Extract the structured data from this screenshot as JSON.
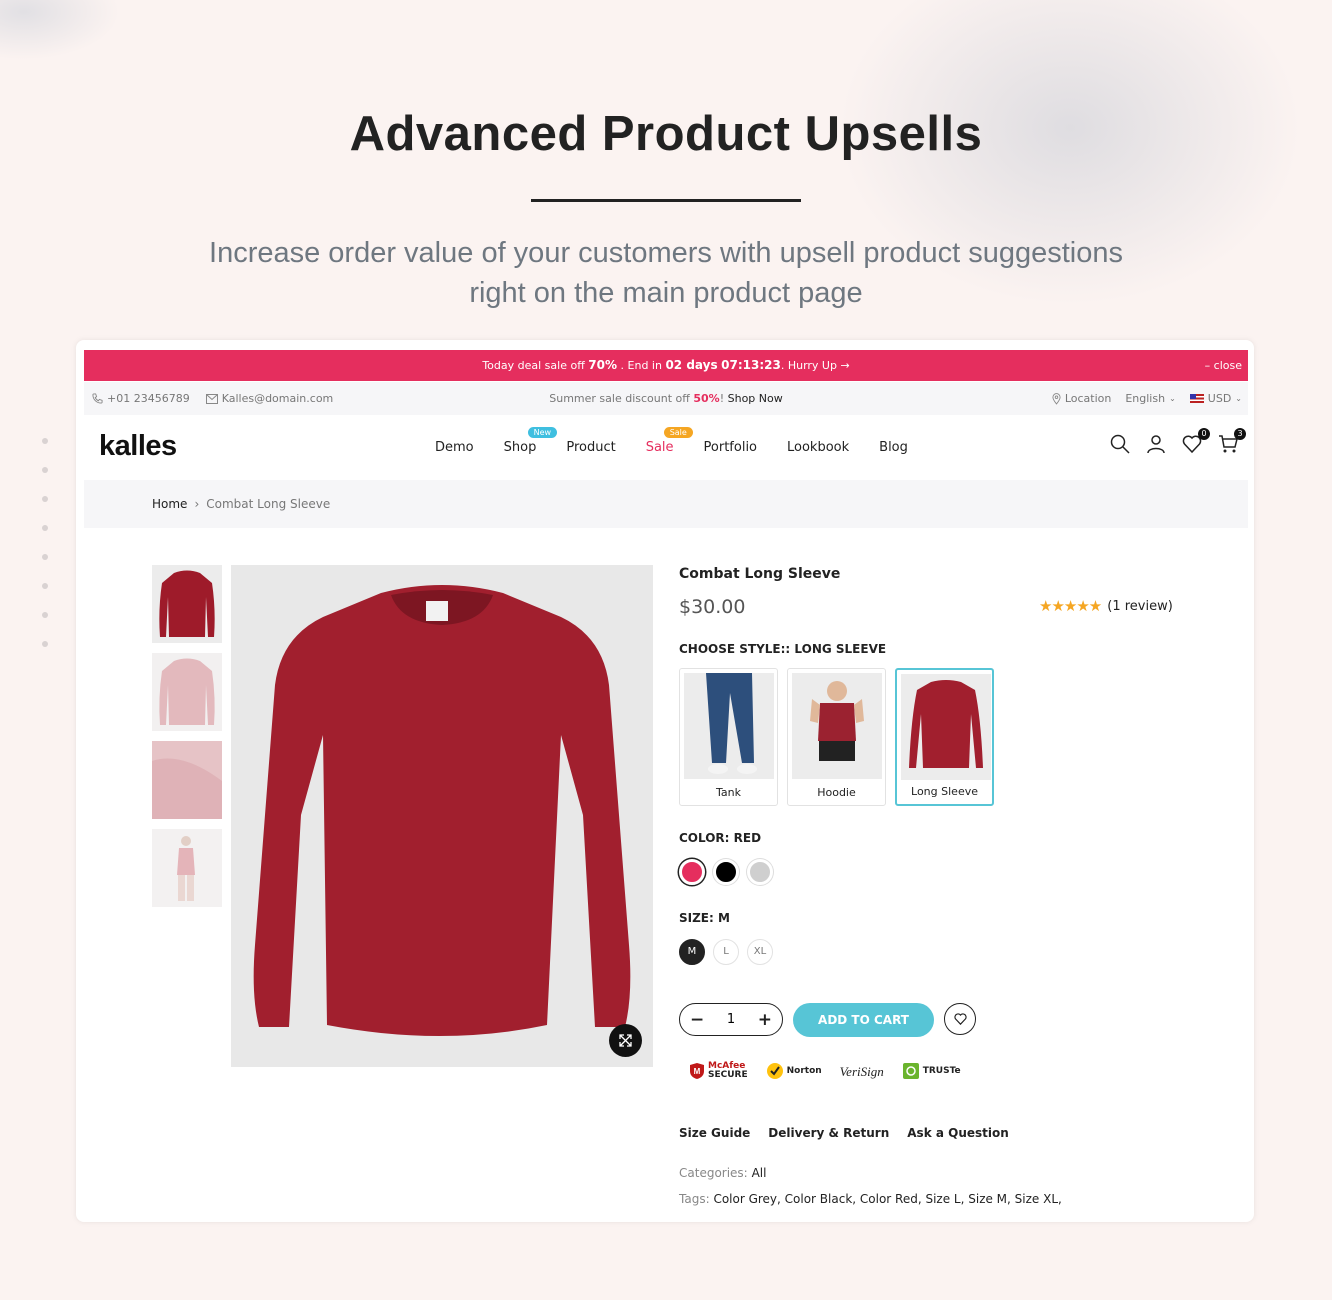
{
  "hero": {
    "title": "Advanced Product Upsells",
    "subtitle_line1": "Increase order value of your customers with upsell product suggestions",
    "subtitle_line2": "right on the main product page"
  },
  "announcement": {
    "text1": "Today deal sale off",
    "pct": "70%",
    "text2": ". End in",
    "days": "02 days",
    "time": "07:13:23",
    "text3": ". Hurry Up →",
    "close": "– close",
    "bg_color": "#e52e5e"
  },
  "topbar": {
    "phone": "+01 23456789",
    "email": "Kalles@domain.com",
    "promo_text": "Summer sale discount off",
    "promo_pct": "50%",
    "promo_sep": "!",
    "promo_link": "Shop Now",
    "location": "Location",
    "language": "English",
    "currency": "USD"
  },
  "header": {
    "logo": "kalles",
    "nav": [
      {
        "label": "Demo"
      },
      {
        "label": "Shop",
        "badge": "New"
      },
      {
        "label": "Product"
      },
      {
        "label": "Sale",
        "badge": "Sale"
      },
      {
        "label": "Portfolio"
      },
      {
        "label": "Lookbook"
      },
      {
        "label": "Blog"
      }
    ],
    "wishlist_count": "0",
    "cart_count": "3"
  },
  "breadcrumb": {
    "home": "Home",
    "sep": "›",
    "current": "Combat Long Sleeve"
  },
  "product": {
    "title": "Combat Long Sleeve",
    "price": "$30.00",
    "stars": "★★★★★",
    "reviews": "(1 review)",
    "style_label": "CHOOSE STYLE:: LONG SLEEVE",
    "styles": [
      {
        "label": "Tank"
      },
      {
        "label": "Hoodie"
      },
      {
        "label": "Long Sleeve",
        "selected": true
      }
    ],
    "color_label": "COLOR: RED",
    "colors": [
      "#e52e5e",
      "#000000",
      "#cfcfcf"
    ],
    "size_label": "SIZE: M",
    "sizes": [
      "M",
      "L",
      "XL"
    ],
    "quantity": "1",
    "add_to_cart": "ADD TO CART",
    "accent_color": "#57c5d6",
    "trust_badges": [
      {
        "line1": "McAfee",
        "line2": "SECURE"
      },
      {
        "line1": "Norton",
        "line2": ""
      },
      {
        "line1": "VeriSign",
        "line2": ""
      },
      {
        "line1": "TRUSTe",
        "line2": ""
      }
    ],
    "links": [
      "Size Guide",
      "Delivery & Return",
      "Ask a Question"
    ],
    "categories_label": "Categories:",
    "categories_value": "All",
    "tags_label": "Tags:",
    "tags_value": "Color Grey, Color Black, Color Red, Size L, Size M, Size XL,"
  }
}
